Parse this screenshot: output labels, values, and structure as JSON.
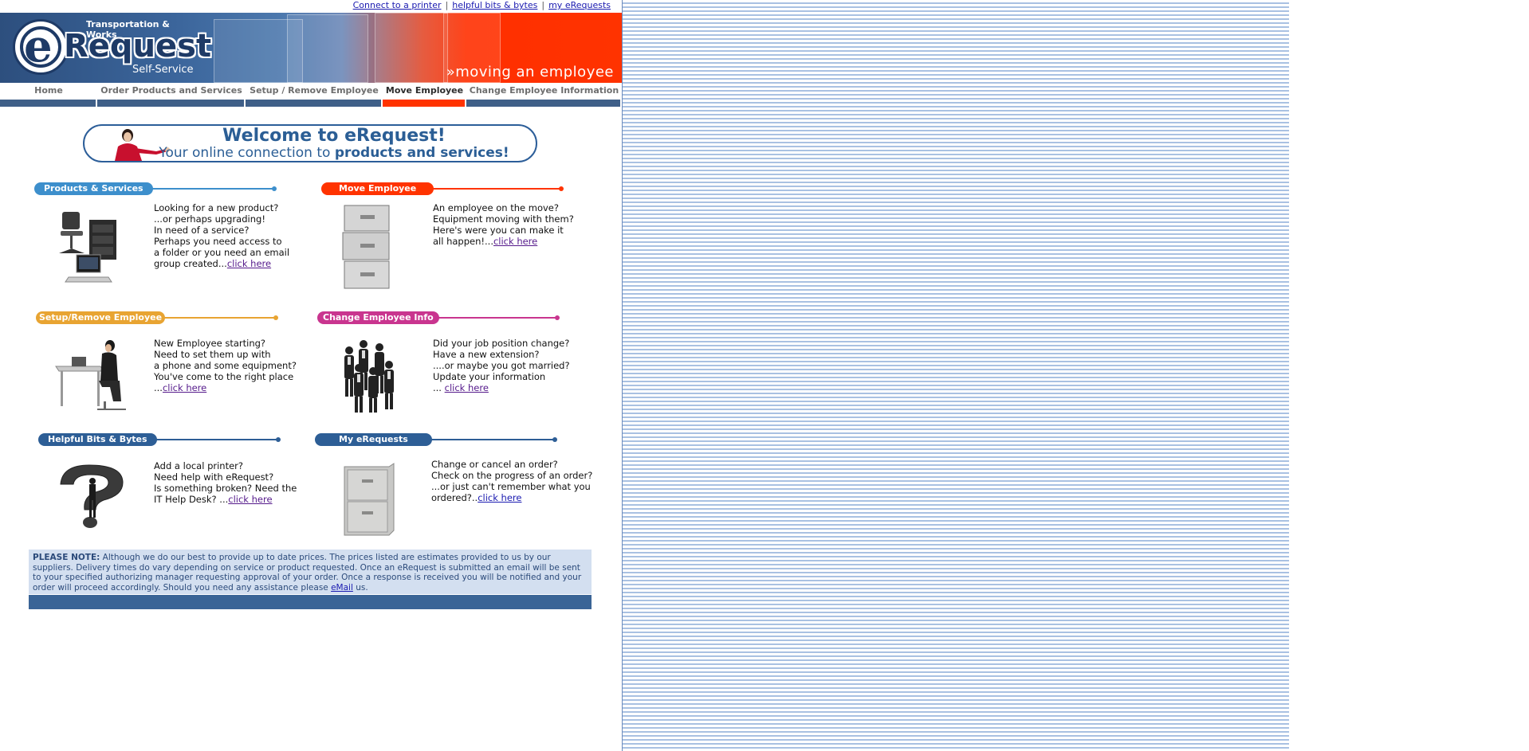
{
  "top_links": [
    "Connect to a printer",
    "helpful bits & bytes",
    "my eRequests"
  ],
  "top_link_separator": "|",
  "logo": {
    "subtitle_top": "Transportation & Works",
    "letter_e": "e",
    "name_rest": "Request",
    "subtitle_bottom": "Self-Service"
  },
  "banner_tagline": "»moving an employee",
  "nav": {
    "tabs": [
      {
        "label": "Home",
        "active": false
      },
      {
        "label": "Order Products and Services",
        "active": false
      },
      {
        "label": "Setup / Remove Employee",
        "active": false
      },
      {
        "label": "Move Employee",
        "active": true
      },
      {
        "label": "Change Employee Information",
        "active": false
      }
    ]
  },
  "welcome": {
    "title": "Welcome to eRequest!",
    "subtitle_prefix": "Your online connection to ",
    "subtitle_bold": "products and services!"
  },
  "sections": {
    "products": {
      "title": "Products & Services",
      "color": "#3d8fcc",
      "lines": [
        "Looking for a new product?",
        "...or perhaps upgrading!",
        "In need of a service?",
        "Perhaps you need access to",
        "a folder or you need an email"
      ],
      "last_prefix": "group created...",
      "link": "click here"
    },
    "move": {
      "title": "Move Employee",
      "color": "#ff3300",
      "lines": [
        "An employee on the move?",
        "Equipment moving with them?",
        "Here's were you can make it"
      ],
      "last_prefix": "all happen!...",
      "link": "click here"
    },
    "setup": {
      "title": "Setup/Remove Employee",
      "color": "#e8a432",
      "lines": [
        "New Employee starting?",
        "Need to set them up with",
        "a phone and some equipment?",
        "You've come to the right place"
      ],
      "last_prefix": "...",
      "link": "click here"
    },
    "change": {
      "title": "Change Employee Info",
      "color": "#c9358f",
      "lines": [
        "Did your job position change?",
        "Have a new extension?",
        "....or maybe you got married?",
        "Update your information"
      ],
      "last_prefix": "... ",
      "link": "click here"
    },
    "helpful": {
      "title": "Helpful Bits & Bytes",
      "color": "#2d5e96",
      "lines": [
        "Add a local printer?",
        "Need help with eRequest?",
        "Is something broken? Need the"
      ],
      "last_prefix": "IT Help Desk? ...",
      "link": "click here"
    },
    "my": {
      "title": "My eRequests",
      "color": "#2d5e96",
      "lines": [
        "Change or cancel an order?",
        "Check on the progress of an order?",
        "...or just can't remember what you"
      ],
      "last_prefix": "ordered?..",
      "link": "click here"
    }
  },
  "note": {
    "label": "PLEASE NOTE:",
    "text": " Although we do our best to provide up to date prices. The prices listed are estimates provided to us by our suppliers. Delivery times do vary depending on service or product requested. Once an eRequest is submitted an email will be sent to your specified authorizing manager requesting approval of your order. Once a response is received you will be notified and your order will proceed accordingly. Should you need any assistance please ",
    "link": "eMail",
    "suffix": " us."
  }
}
